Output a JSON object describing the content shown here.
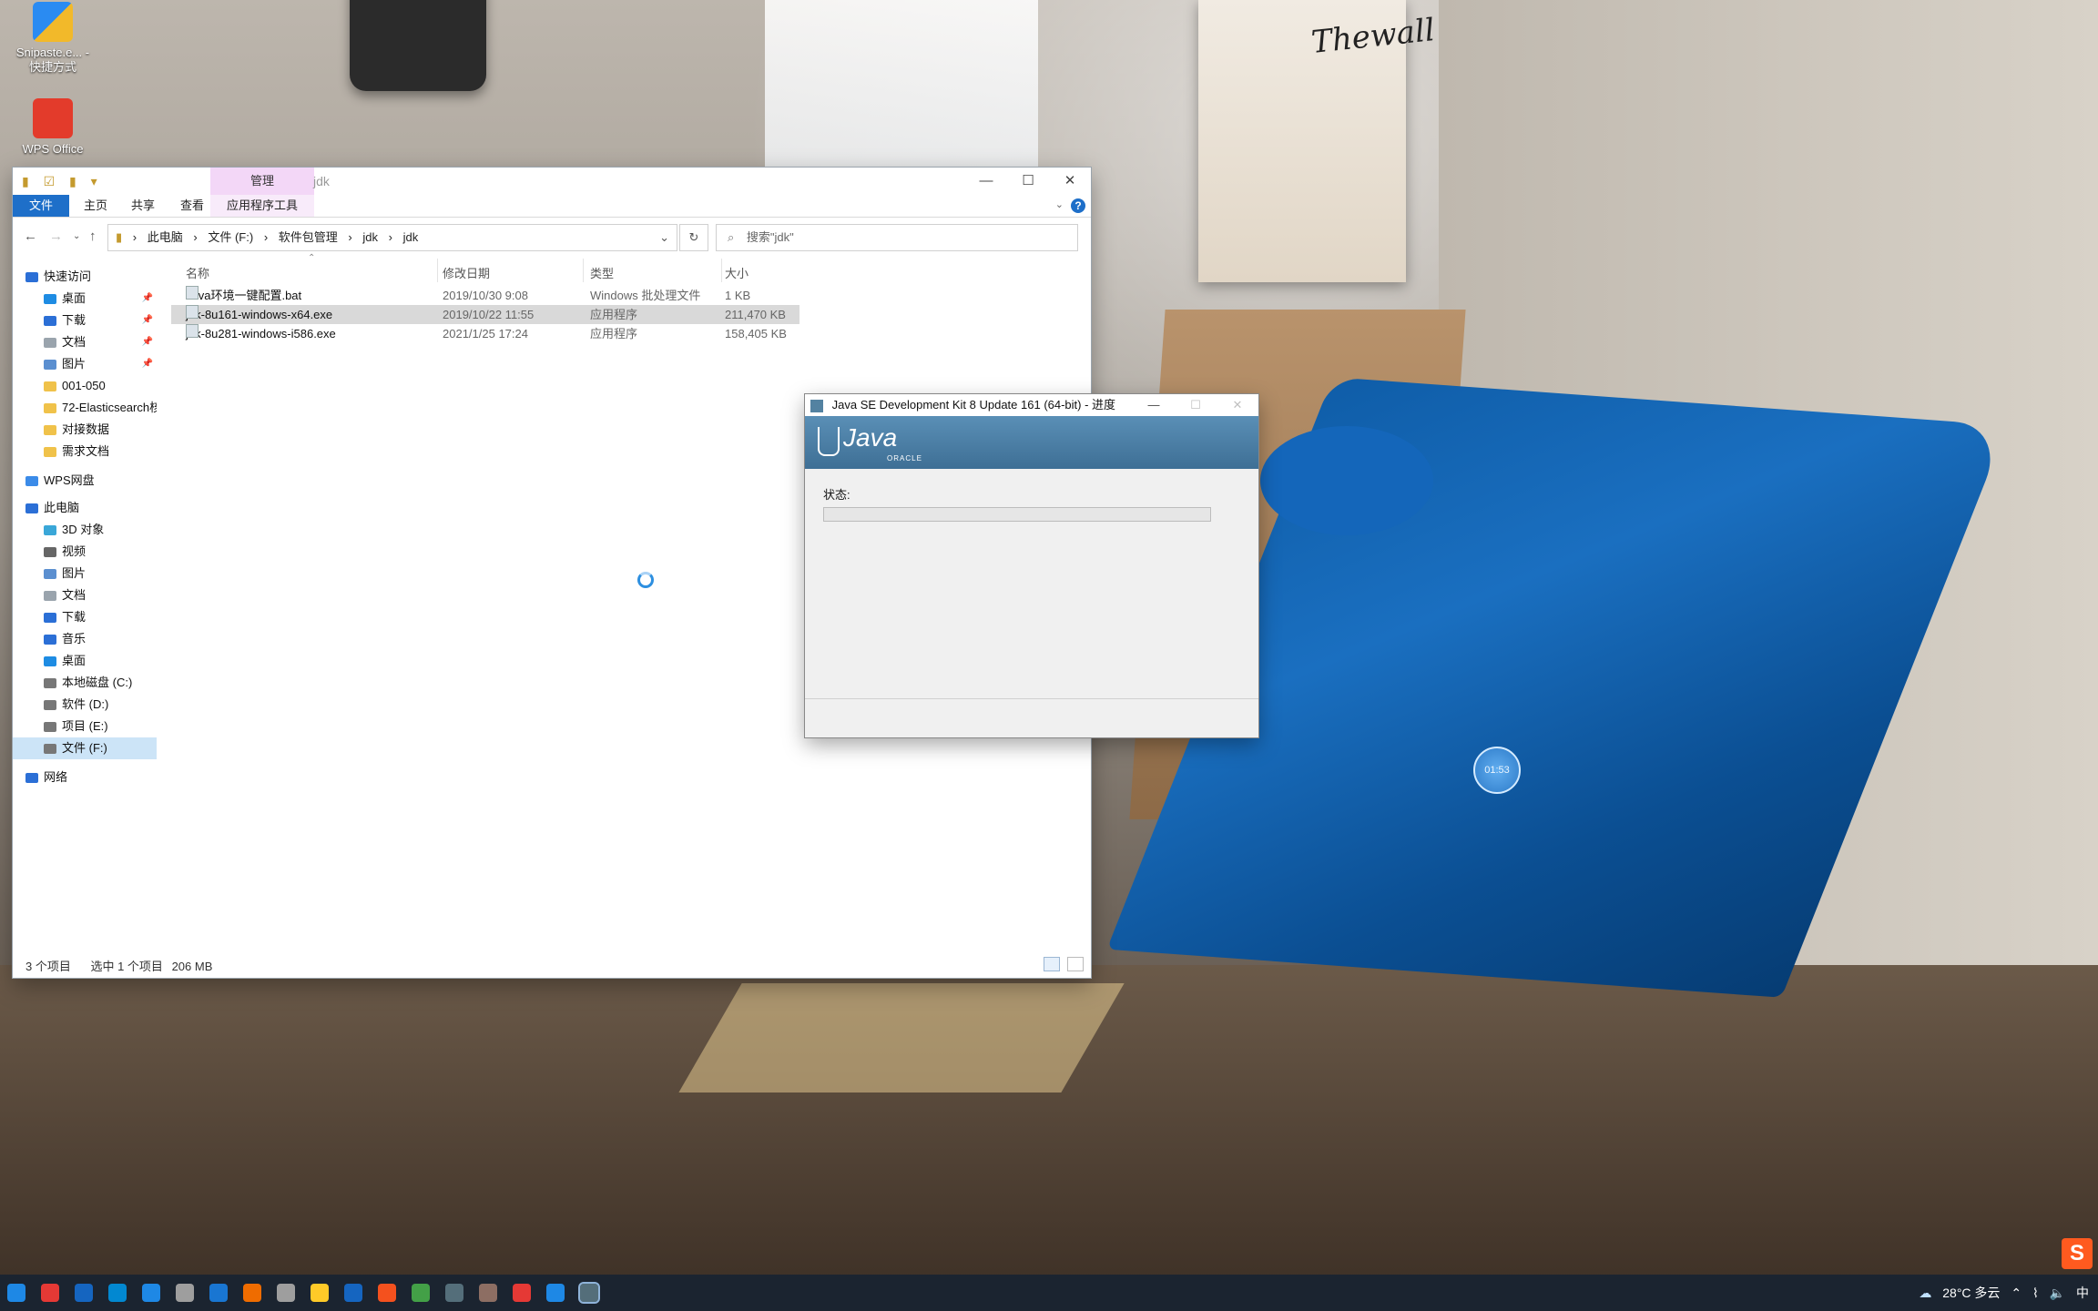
{
  "desktop": {
    "icons": [
      {
        "label": "Snipaste.e... - 快捷方式",
        "color": "#2a8bf2"
      },
      {
        "label": "WPS Office",
        "color": "#e33b2b"
      }
    ],
    "poster_text": "Thewall",
    "bubble_text": "01:53"
  },
  "explorer": {
    "title": "jdk",
    "context_tab": "管理",
    "ribbon_tabs": [
      "文件",
      "主页",
      "共享",
      "查看",
      "应用程序工具"
    ],
    "address": [
      "此电脑",
      "文件 (F:)",
      "软件包管理",
      "jdk",
      "jdk"
    ],
    "search_placeholder": "搜索\"jdk\"",
    "nav": [
      {
        "label": "快速访问",
        "color": "#2b6fd6",
        "pinned": false
      },
      {
        "label": "桌面",
        "color": "#1e8ce3",
        "pinned": true
      },
      {
        "label": "下载",
        "color": "#2b6fd6",
        "pinned": true
      },
      {
        "label": "文档",
        "color": "#9aa4ad",
        "pinned": true
      },
      {
        "label": "图片",
        "color": "#5b8fd0",
        "pinned": true
      },
      {
        "label": "001-050",
        "color": "#f0c24a",
        "pinned": false
      },
      {
        "label": "72-Elasticsearch核",
        "color": "#f0c24a",
        "pinned": false
      },
      {
        "label": "对接数据",
        "color": "#f0c24a",
        "pinned": false
      },
      {
        "label": "需求文档",
        "color": "#f0c24a",
        "pinned": false
      },
      {
        "label": "WPS网盘",
        "color": "#3b8be8",
        "pinned": false
      },
      {
        "label": "此电脑",
        "color": "#2b6fd6",
        "pinned": false
      },
      {
        "label": "3D 对象",
        "color": "#3aa7d8",
        "pinned": false
      },
      {
        "label": "视频",
        "color": "#666",
        "pinned": false
      },
      {
        "label": "图片",
        "color": "#5b8fd0",
        "pinned": false
      },
      {
        "label": "文档",
        "color": "#9aa4ad",
        "pinned": false
      },
      {
        "label": "下载",
        "color": "#2b6fd6",
        "pinned": false
      },
      {
        "label": "音乐",
        "color": "#2b6fd6",
        "pinned": false
      },
      {
        "label": "桌面",
        "color": "#1e8ce3",
        "pinned": false
      },
      {
        "label": "本地磁盘 (C:)",
        "color": "#777",
        "pinned": false
      },
      {
        "label": "软件 (D:)",
        "color": "#777",
        "pinned": false
      },
      {
        "label": "项目 (E:)",
        "color": "#777",
        "pinned": false
      },
      {
        "label": "文件 (F:)",
        "color": "#777",
        "pinned": false,
        "selected": true
      },
      {
        "label": "网络",
        "color": "#2b6fd6",
        "pinned": false
      }
    ],
    "columns": [
      "名称",
      "修改日期",
      "类型",
      "大小"
    ],
    "files": [
      {
        "name": "Java环境一键配置.bat",
        "date": "2019/10/30 9:08",
        "type": "Windows 批处理文件",
        "size": "1 KB"
      },
      {
        "name": "jdk-8u161-windows-x64.exe",
        "date": "2019/10/22 11:55",
        "type": "应用程序",
        "size": "211,470 KB",
        "selected": true
      },
      {
        "name": "jdk-8u281-windows-i586.exe",
        "date": "2021/1/25 17:24",
        "type": "应用程序",
        "size": "158,405 KB"
      }
    ],
    "status": {
      "count": "3 个项目",
      "selection": "选中 1 个项目",
      "size": "206 MB"
    }
  },
  "java_dialog": {
    "title": "Java SE Development Kit 8 Update 161 (64-bit) - 进度",
    "brand": "Java",
    "brand_sub": "ORACLE",
    "status_label": "状态:",
    "progress": 0
  },
  "taskbar": {
    "weather": "28°C 多云",
    "ime": "中",
    "apps": [
      "#1e88e5",
      "#e53935",
      "#1565c0",
      "#0288d1",
      "#1e88e5",
      "#9e9e9e",
      "#1976d2",
      "#ef6c00",
      "#9e9e9e",
      "#ffca28",
      "#1565c0",
      "#f4511e",
      "#43a047",
      "#546e7a",
      "#8d6e63",
      "#e53935",
      "#1e88e5",
      "#546e7a"
    ]
  }
}
